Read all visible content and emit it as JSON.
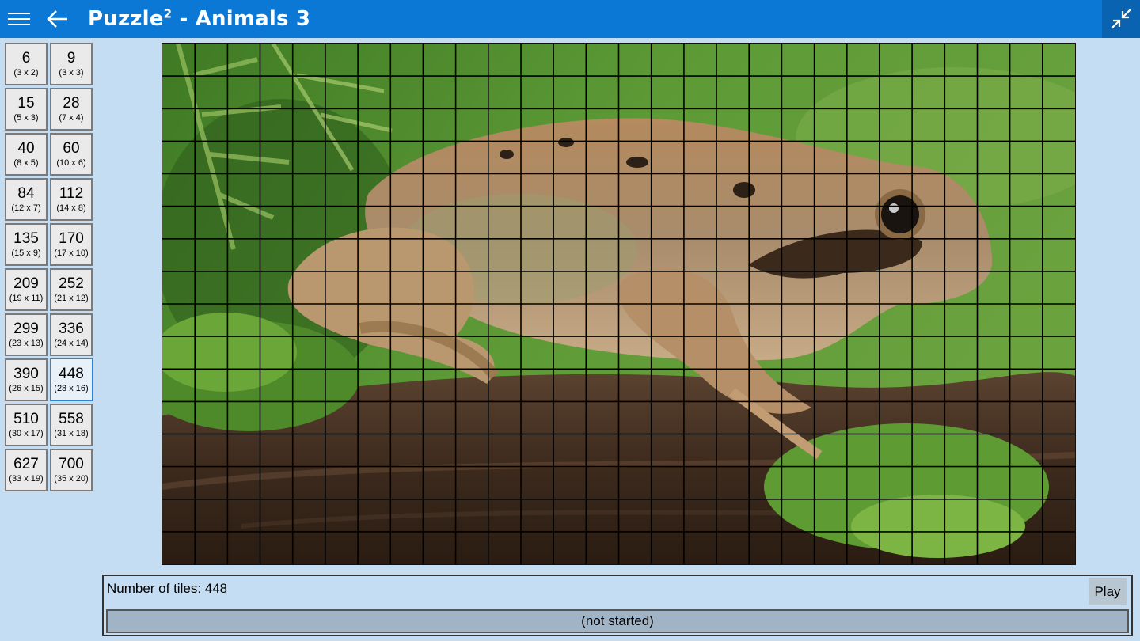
{
  "header": {
    "title_prefix": "Puzzle",
    "title_sup": "2",
    "title_rest": " - Animals 3",
    "icons": {
      "menu": "hamburger-icon",
      "back": "back-arrow-icon",
      "compact": "compact-overlay-icon"
    },
    "accent": "#0b78d6"
  },
  "tiles": [
    {
      "count": "6",
      "dims": "(3 x 2)"
    },
    {
      "count": "9",
      "dims": "(3 x 3)"
    },
    {
      "count": "15",
      "dims": "(5 x 3)"
    },
    {
      "count": "28",
      "dims": "(7 x 4)"
    },
    {
      "count": "40",
      "dims": "(8 x 5)"
    },
    {
      "count": "60",
      "dims": "(10 x 6)"
    },
    {
      "count": "84",
      "dims": "(12 x 7)"
    },
    {
      "count": "112",
      "dims": "(14 x 8)"
    },
    {
      "count": "135",
      "dims": "(15 x 9)"
    },
    {
      "count": "170",
      "dims": "(17 x 10)"
    },
    {
      "count": "209",
      "dims": "(19 x 11)"
    },
    {
      "count": "252",
      "dims": "(21 x 12)"
    },
    {
      "count": "299",
      "dims": "(23 x 13)"
    },
    {
      "count": "336",
      "dims": "(24 x 14)"
    },
    {
      "count": "390",
      "dims": "(26 x 15)"
    },
    {
      "count": "448",
      "dims": "(28 x 16)",
      "selected": true
    },
    {
      "count": "510",
      "dims": "(30 x 17)"
    },
    {
      "count": "558",
      "dims": "(31 x 18)"
    },
    {
      "count": "627",
      "dims": "(33 x 19)"
    },
    {
      "count": "700",
      "dims": "(35 x 20)"
    }
  ],
  "puzzle": {
    "columns": 28,
    "rows": 16,
    "subject": "frog-on-log-image"
  },
  "status": {
    "tiles_label": "Number of tiles: 448",
    "play_label": "Play",
    "progress_text": "(not started)",
    "progress": 0
  }
}
